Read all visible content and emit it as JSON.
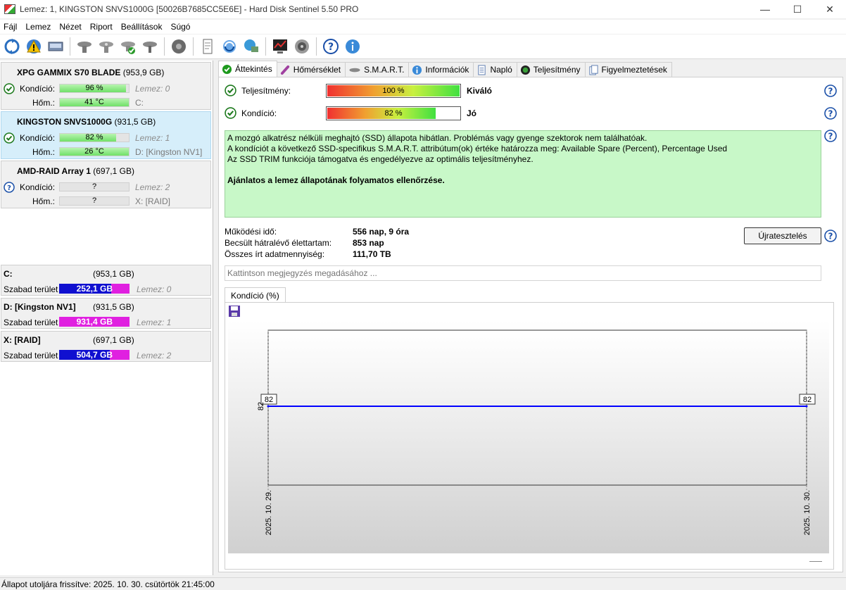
{
  "window": {
    "title": "Lemez: 1, KINGSTON SNVS1000G [50026B7685CC5E6E]  -  Hard Disk Sentinel 5.50 PRO",
    "minimize": "—",
    "maximize": "☐",
    "close": "✕"
  },
  "menu": [
    "Fájl",
    "Lemez",
    "Nézet",
    "Riport",
    "Beállítások",
    "Súgó"
  ],
  "toolbar_icons": [
    "refresh-icon",
    "warning-icon",
    "disk-icon",
    "hdd-icon-1",
    "hdd-icon-2",
    "hdd-check-icon",
    "hdd-icon-3",
    "gear-icon",
    "report-icon",
    "update-icon",
    "network-icon",
    "chart-icon",
    "speaker-icon",
    "help-icon",
    "info-icon"
  ],
  "disks": [
    {
      "name": "XPG GAMMIX S70 BLADE",
      "size": "(953,9 GB)",
      "health_label": "Kondíció:",
      "health": "96 %",
      "health_fraction": 0.96,
      "temp_label": "Hőm.:",
      "temp": "41 °C",
      "temp_fraction": 1.0,
      "disk_ref": "Lemez: 0",
      "drive": "C:",
      "status": "ok"
    },
    {
      "name": "KINGSTON SNVS1000G",
      "size": "(931,5 GB)",
      "health_label": "Kondíció:",
      "health": "82 %",
      "health_fraction": 0.82,
      "temp_label": "Hőm.:",
      "temp": "26 °C",
      "temp_fraction": 1.0,
      "disk_ref": "Lemez: 1",
      "drive": "D: [Kingston NV1]",
      "status": "ok"
    },
    {
      "name": "AMD-RAID Array 1",
      "size": "(697,1 GB)",
      "health_label": "Kondíció:",
      "health": "?",
      "health_fraction": 0,
      "temp_label": "Hőm.:",
      "temp": "?",
      "temp_fraction": 0,
      "disk_ref": "Lemez: 2",
      "drive": "X: [RAID]",
      "status": "unknown"
    }
  ],
  "volumes": [
    {
      "name": "C:",
      "size": "(953,1 GB)",
      "free_label": "Szabad terület",
      "free": "252,1 GB",
      "used_fraction": 0.74,
      "disk_ref": "Lemez: 0"
    },
    {
      "name": "D: [Kingston NV1]",
      "size": "(931,5 GB)",
      "free_label": "Szabad terület",
      "free": "931,4 GB",
      "used_fraction": 0.0,
      "disk_ref": "Lemez: 1"
    },
    {
      "name": "X: [RAID]",
      "size": "(697,1 GB)",
      "free_label": "Szabad terület",
      "free": "504,7 GB",
      "used_fraction": 0.72,
      "disk_ref": "Lemez: 2"
    }
  ],
  "tabs": [
    {
      "label": "Áttekintés",
      "icon": "check-circle-icon",
      "active": true
    },
    {
      "label": "Hőmérséklet",
      "icon": "thermometer-icon",
      "active": false
    },
    {
      "label": "S.M.A.R.T.",
      "icon": "smart-icon",
      "active": false
    },
    {
      "label": "Információk",
      "icon": "info-icon",
      "active": false
    },
    {
      "label": "Napló",
      "icon": "log-icon",
      "active": false
    },
    {
      "label": "Teljesítmény",
      "icon": "performance-icon",
      "active": false
    },
    {
      "label": "Figyelmeztetések",
      "icon": "alerts-icon",
      "active": false
    }
  ],
  "overview": {
    "performance_label": "Teljesítmény:",
    "performance_value": "100 %",
    "performance_fraction": 1.0,
    "performance_verdict": "Kiváló",
    "health_label": "Kondíció:",
    "health_value": "82 %",
    "health_fraction": 0.82,
    "health_verdict": "Jó",
    "info_lines": [
      "A mozgó alkatrész nélküli meghajtó (SSD) állapota hibátlan. Problémás vagy gyenge szektorok nem találhatóak.",
      "A kondíciót a következő SSD-specifikus S.M.A.R.T. attribútum(ok) értéke határozza meg:  Available Spare (Percent), Percentage Used",
      "Az SSD TRIM funkciója támogatva és engedélyezve az optimális teljesítményhez."
    ],
    "recommendation": "Ajánlatos a lemez állapotának folyamatos ellenőrzése.",
    "uptime_label": "Működési idő:",
    "uptime_value": "556 nap, 9 óra",
    "remaining_label": "Becsült hátralévő élettartam:",
    "remaining_value": "853 nap",
    "written_label": "Összes írt adatmennyiség:",
    "written_value": "111,70 TB",
    "reset_button": "Újratesztelés",
    "note_placeholder": "Kattintson megjegyzés megadásához ...",
    "chart_tab": "Kondíció  (%)"
  },
  "chart_data": {
    "type": "line",
    "x": [
      "2025. 10. 29.",
      "2025. 10. 30."
    ],
    "y": [
      82,
      82
    ],
    "y_tick": "82",
    "point_labels": [
      "82",
      "82"
    ],
    "color": "#0000ff",
    "grid": false
  },
  "statusbar": {
    "text": "Állapot utoljára frissítve: 2025. 10. 30. csütörtök 21:45:00"
  },
  "colors": {
    "selected_card": "#d6eefa",
    "info_box": "#c8f8c8",
    "health_bar": "#70e068",
    "volume_used": "#1010d0",
    "volume_free": "#e020e0"
  }
}
